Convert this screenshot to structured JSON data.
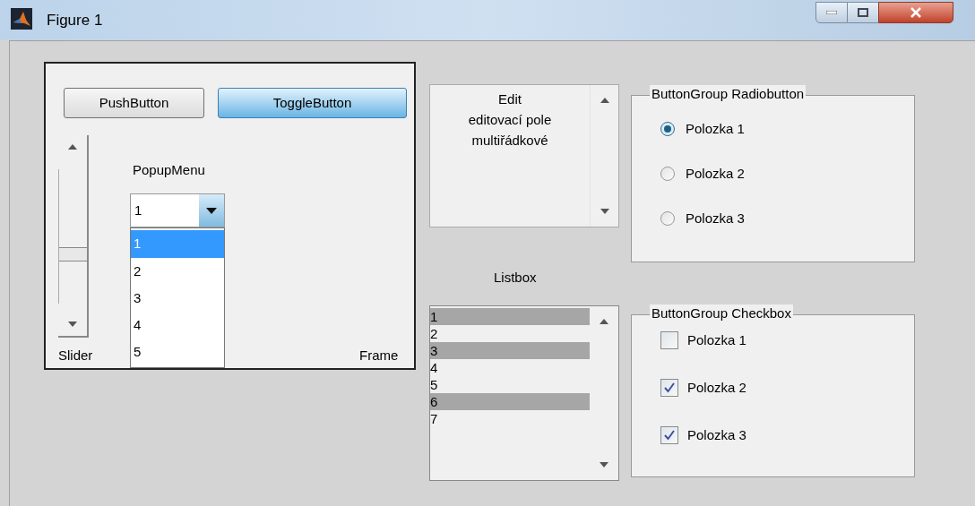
{
  "window": {
    "title": "Figure 1"
  },
  "frame": {
    "label": "Frame",
    "push_button": {
      "label": "PushButton"
    },
    "toggle_button": {
      "label": "ToggleButton",
      "selected": true
    },
    "slider": {
      "label": "Slider",
      "level": 0.35
    },
    "popup_menu": {
      "label": "PopupMenu",
      "value": "1",
      "expanded": true,
      "options": [
        {
          "label": "1",
          "selected": true
        },
        {
          "label": "2",
          "selected": false
        },
        {
          "label": "3",
          "selected": false
        },
        {
          "label": "4",
          "selected": false
        },
        {
          "label": "5",
          "selected": false
        }
      ]
    }
  },
  "edit": {
    "lines": [
      "Edit",
      "editovací pole",
      "multiřádkové"
    ]
  },
  "listbox": {
    "label": "Listbox",
    "items": [
      {
        "label": "1",
        "selected": true
      },
      {
        "label": "2",
        "selected": false
      },
      {
        "label": "3",
        "selected": true
      },
      {
        "label": "4",
        "selected": false
      },
      {
        "label": "5",
        "selected": false
      },
      {
        "label": "6",
        "selected": true
      },
      {
        "label": "7",
        "selected": false
      }
    ]
  },
  "radio_group": {
    "title": "ButtonGroup Radiobutton",
    "items": [
      {
        "label": "Polozka 1",
        "selected": true
      },
      {
        "label": "Polozka 2",
        "selected": false
      },
      {
        "label": "Polozka 3",
        "selected": false
      }
    ]
  },
  "checkbox_group": {
    "title": "ButtonGroup Checkbox",
    "items": [
      {
        "label": "Polozka 1",
        "checked": false
      },
      {
        "label": "Polozka 2",
        "checked": true
      },
      {
        "label": "Polozka 3",
        "checked": true
      }
    ]
  }
}
